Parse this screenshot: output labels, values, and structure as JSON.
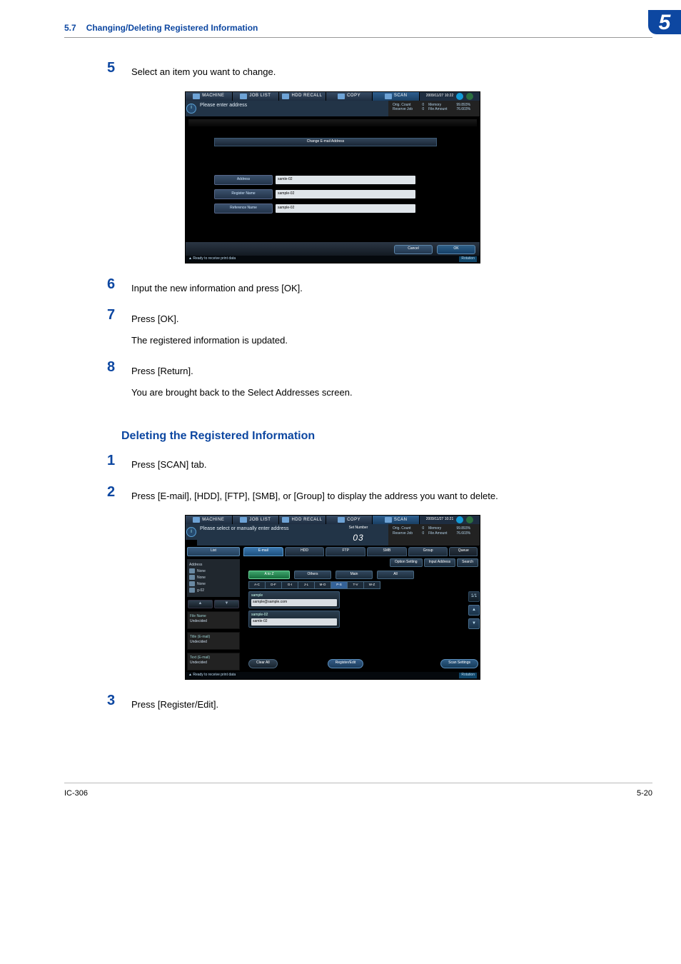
{
  "header": {
    "secnum": "5.7",
    "sectitle": "Changing/Deleting Registered Information",
    "chapter": "5"
  },
  "content": {
    "step5": {
      "num": "5",
      "text": "Select an item you want to change."
    },
    "step6": {
      "num": "6",
      "text": "Input the new information and press [OK]."
    },
    "step7": {
      "num": "7",
      "text1": "Press [OK].",
      "text2": "The registered information is updated."
    },
    "step8": {
      "num": "8",
      "text1": "Press [Return].",
      "text2": "You are brought back to the Select Addresses screen."
    },
    "subhead": "Deleting the Registered Information",
    "d1": {
      "num": "1",
      "text": "Press [SCAN] tab."
    },
    "d2": {
      "num": "2",
      "text": "Press [E-mail], [HDD], [FTP], [SMB], or [Group] to display the address you want to delete."
    },
    "d3": {
      "num": "3",
      "text": "Press [Register/Edit]."
    }
  },
  "screen1": {
    "tabs": {
      "machine": "MACHINE",
      "joblist": "JOB LIST",
      "hdd": "HDD RECALL",
      "copy": "COPY",
      "scan": "SCAN"
    },
    "time": "2009/11/27 10:22",
    "msg": "Please enter address",
    "status": {
      "orig_count_l": "Orig. Count",
      "orig_count_v": "0",
      "reserve_l": "Reserve Job",
      "reserve_v": "0",
      "mem_l": "Memory",
      "mem_v": "99.893%",
      "file_l": "File Amount",
      "file_v": "76.603%"
    },
    "panel_title": "Change E-mail Address",
    "field_labels": {
      "address": "Address",
      "regname": "Register Name",
      "refname": "Reference Name"
    },
    "field_values": {
      "address": "samle-02",
      "regname": "sample-02",
      "refname": "sample-02"
    },
    "buttons": {
      "cancel": "Cancel",
      "ok": "OK"
    },
    "footer": {
      "ready": "Ready to receive print data",
      "lock": "▲",
      "rot": "Rotation"
    }
  },
  "screen2": {
    "tabs": {
      "machine": "MACHINE",
      "joblist": "JOB LIST",
      "hdd": "HDD RECALL",
      "copy": "COPY",
      "scan": "SCAN"
    },
    "time": "2009/11/27 10:21",
    "msg": "Please select or manually enter address",
    "setnumber_l": "Set Number",
    "setnumber": "03",
    "status": {
      "orig_count_l": "Orig. Count",
      "orig_count_v": "0",
      "reserve_l": "Reserve Job",
      "reserve_v": "0",
      "mem_l": "Memory",
      "mem_v": "99.893%",
      "file_l": "File Amount",
      "file_v": "76.603%"
    },
    "left": {
      "list": "List",
      "address": "Address",
      "ftpnone": "None",
      "hddnone": "None",
      "smbnone": "None",
      "gitem": "g-02",
      "file_l": "File Name",
      "file_v": "Undecided",
      "title_l": "Title (E-mail)",
      "title_v": "Undecided",
      "text_l": "Text (E-mail)",
      "text_v": "Undecided",
      "up": "▲",
      "dn": "▼"
    },
    "typetabs": {
      "email": "E-mail",
      "hdd": "HDD",
      "ftp": "FTP",
      "smb": "SMB",
      "group": "Group",
      "queue": "Queue"
    },
    "opt": {
      "setting": "Option Setting",
      "input": "Input Address",
      "search": "Search"
    },
    "filters": {
      "az": "A to Z",
      "others": "Others",
      "main": "Main",
      "all": "All"
    },
    "alpha": {
      "ac": "A-C",
      "df": "D-F",
      "gi": "G-I",
      "jl": "J-L",
      "mo": "M-O",
      "ps": "P-S",
      "tv": "T-V",
      "wz": "W-Z"
    },
    "addr1": {
      "name": "sample",
      "val": "sample@sample.com"
    },
    "addr2": {
      "name": "sample-02",
      "val": "samle-02"
    },
    "scroll": {
      "count": "1",
      "sep": "/",
      "total": "1",
      "up": "▲",
      "dn": "▼"
    },
    "bottom": {
      "clear": "Clear All",
      "reg": "Register/Edit",
      "scan": "Scan Settings"
    },
    "footer": {
      "ready": "Ready to receive print data",
      "rot": "Rotation"
    }
  },
  "footer": {
    "left": "IC-306",
    "right": "5-20"
  }
}
